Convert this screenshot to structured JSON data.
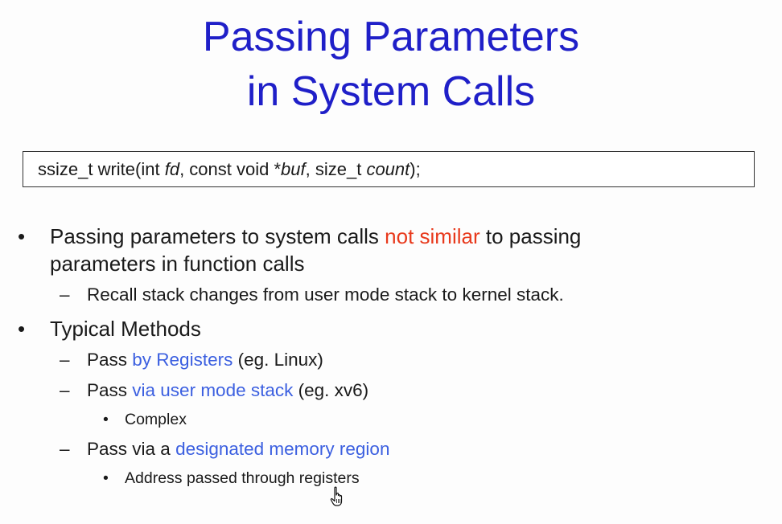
{
  "title": {
    "line1": "Passing Parameters",
    "line2": "in System Calls"
  },
  "code": {
    "prefix": "ssize_t write(int ",
    "fd": "fd",
    "mid1": ", const void *",
    "buf": "buf",
    "mid2": ", size_t ",
    "count": "count",
    "suffix": ");"
  },
  "bullets": {
    "b1": {
      "marker": "•",
      "pre": "Passing parameters to system calls ",
      "highlight": "not similar",
      "post": " to passing",
      "line2": "parameters in function calls",
      "sub1": {
        "marker": "–",
        "text": "Recall stack changes from user mode stack to kernel stack."
      }
    },
    "b2": {
      "marker": "•",
      "text": "Typical Methods",
      "s1": {
        "marker": "–",
        "pre": "Pass ",
        "highlight": "by Registers",
        "post": " (eg. Linux)"
      },
      "s2": {
        "marker": "–",
        "pre": "Pass ",
        "highlight": "via user mode stack",
        "post": " (eg. xv6)",
        "sub": {
          "marker": "•",
          "text": "Complex"
        }
      },
      "s3": {
        "marker": "–",
        "pre": "Pass via a ",
        "highlight": "designated memory region",
        "sub": {
          "marker": "•",
          "text": "Address passed through registers"
        }
      }
    }
  },
  "colors": {
    "title": "#1f1fc8",
    "emphasis_red": "#e8391c",
    "emphasis_blue": "#3b5fe0"
  },
  "icons": {
    "cursor": "hand-pointer-icon"
  }
}
